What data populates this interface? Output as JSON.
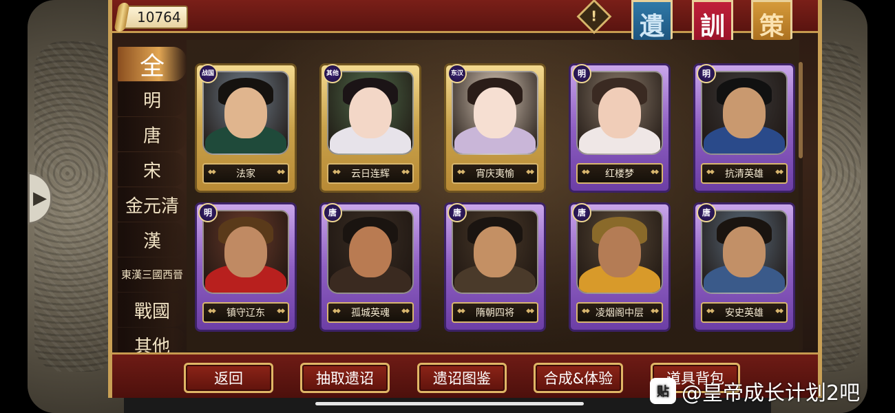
{
  "currency": {
    "value": "10764"
  },
  "warning": {
    "symbol": "!"
  },
  "banners": [
    "遺",
    "訓",
    "策"
  ],
  "categories": [
    {
      "label": "全",
      "active": true
    },
    {
      "label": "明"
    },
    {
      "label": "唐"
    },
    {
      "label": "宋"
    },
    {
      "label": "金元清"
    },
    {
      "label": "漢"
    },
    {
      "label": "東漢三國西晉"
    },
    {
      "label": "戰國"
    },
    {
      "label": "其他"
    }
  ],
  "cards": [
    {
      "era": "战国",
      "name": "法家",
      "frame": "gold"
    },
    {
      "era": "其他",
      "name": "云日连辉",
      "frame": "gold"
    },
    {
      "era": "东汉",
      "name": "宵庆夷愉",
      "frame": "gold"
    },
    {
      "era": "明",
      "name": "红楼梦",
      "frame": "purple"
    },
    {
      "era": "明",
      "name": "抗清英雄",
      "frame": "purple"
    },
    {
      "era": "明",
      "name": "镇守辽东",
      "frame": "purple"
    },
    {
      "era": "唐",
      "name": "孤城英魂",
      "frame": "purple"
    },
    {
      "era": "唐",
      "name": "隋朝四将",
      "frame": "purple"
    },
    {
      "era": "唐",
      "name": "凌烟阁中层",
      "frame": "purple"
    },
    {
      "era": "唐",
      "name": "安史英雄",
      "frame": "purple"
    }
  ],
  "buttons": {
    "back": "返回",
    "draw": "抽取遗诏",
    "gallery": "遗诏图鉴",
    "combine": "合成&体验",
    "bag": "道具背包"
  },
  "watermark": {
    "logo": "贴",
    "text": "@皇帝成长计划2吧"
  },
  "colors": {
    "gold_frame": "#c9a24b",
    "purple_frame": "#8e5fc2",
    "bar_red": "#6e1b15"
  }
}
